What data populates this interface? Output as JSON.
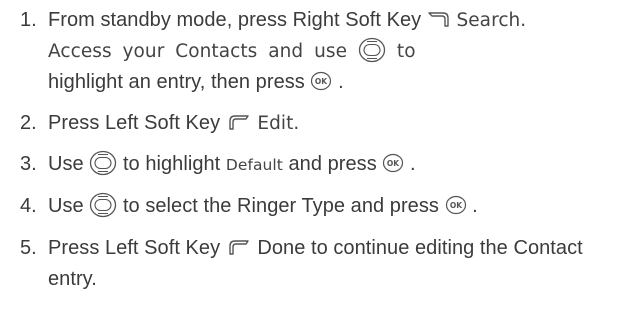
{
  "steps": [
    {
      "number": "1.",
      "line1_a": "From standby mode, press Right Soft Key",
      "line1_b": "Search.",
      "line2_a": "Access your Contacts and use",
      "line2_b": "to",
      "line3_a": "highlight an entry, then press",
      "line3_b": "."
    },
    {
      "number": "2.",
      "text_a": "Press Left Soft Key",
      "text_b": "Edit."
    },
    {
      "number": "3.",
      "text_a": "Use",
      "text_b": "to highlight",
      "text_c": "Default",
      "text_d": "and press",
      "text_e": "."
    },
    {
      "number": "4.",
      "text_a": "Use",
      "text_b": "to select the Ringer Type and press",
      "text_c": "."
    },
    {
      "number": "5.",
      "text_a": "Press Left Soft Key",
      "text_b": "Done to continue editing the Contact",
      "text_c": "entry."
    }
  ],
  "icons": {
    "right_soft_key": "right-soft-key-icon",
    "left_soft_key": "left-soft-key-icon",
    "nav_key": "navigation-key-icon",
    "ok_key": "ok-key-icon",
    "ok_label": "OK"
  }
}
